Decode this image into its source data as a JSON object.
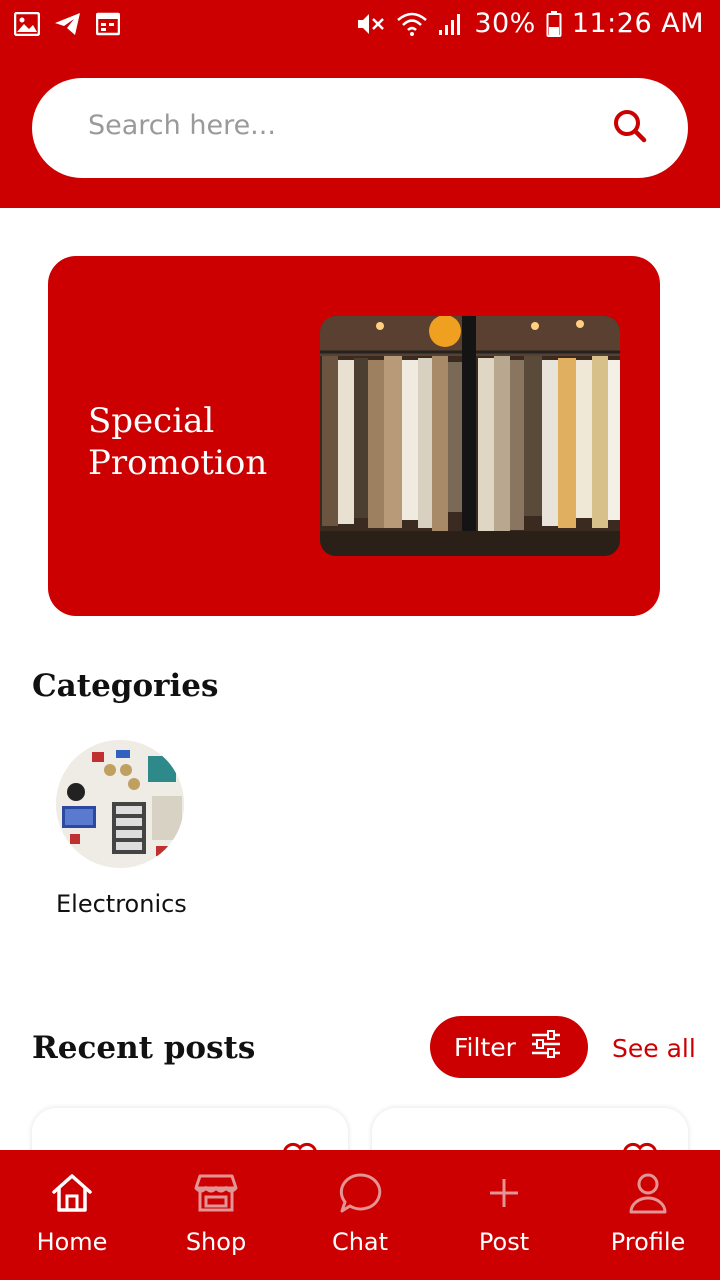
{
  "status_bar": {
    "battery": "30%",
    "time": "11:26 AM"
  },
  "search": {
    "placeholder": "Search here..."
  },
  "promo": {
    "title_line1": "Special",
    "title_line2": "Promotion"
  },
  "categories": {
    "title": "Categories",
    "items": [
      {
        "label": "Electronics"
      }
    ]
  },
  "recent_posts": {
    "title": "Recent posts",
    "filter_label": "Filter",
    "see_all_label": "See all"
  },
  "nav": {
    "items": [
      {
        "label": "Home",
        "icon": "home-icon"
      },
      {
        "label": "Shop",
        "icon": "shop-icon"
      },
      {
        "label": "Chat",
        "icon": "chat-icon"
      },
      {
        "label": "Post",
        "icon": "plus-icon"
      },
      {
        "label": "Profile",
        "icon": "profile-icon"
      }
    ]
  },
  "colors": {
    "primary": "#cc0000",
    "background": "#ffffff",
    "text": "#111111"
  }
}
